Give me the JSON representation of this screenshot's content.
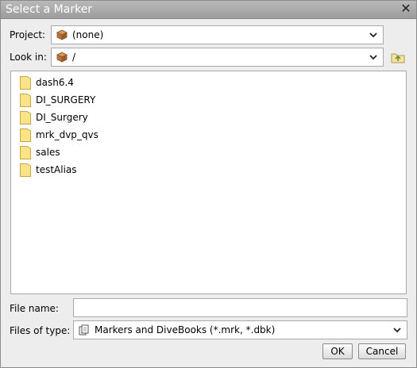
{
  "dialog": {
    "title": "Select a Marker",
    "close_label": "✕"
  },
  "project": {
    "label": "Project:",
    "value": "(none)",
    "icon": "package-icon"
  },
  "lookin": {
    "label": "Look in:",
    "value": "/",
    "icon": "package-icon",
    "up_icon": "up-folder-icon"
  },
  "files": [
    {
      "name": "dash6.4",
      "icon": "folder-icon"
    },
    {
      "name": "DI_SURGERY",
      "icon": "folder-icon"
    },
    {
      "name": "DI_Surgery",
      "icon": "folder-icon"
    },
    {
      "name": "mrk_dvp_qvs",
      "icon": "folder-icon"
    },
    {
      "name": "sales",
      "icon": "folder-icon"
    },
    {
      "name": "testAlias",
      "icon": "folder-icon"
    }
  ],
  "filename": {
    "label": "File name:",
    "value": "",
    "placeholder": ""
  },
  "filetype": {
    "label": "Files of type:",
    "value": "Markers and DiveBooks (*.mrk, *.dbk)",
    "icon": "documents-icon"
  },
  "buttons": {
    "ok": "OK",
    "cancel": "Cancel"
  },
  "colors": {
    "titlebar": "#a8a8a8",
    "dialog_bg": "#ededed",
    "folder_fill": "#fbe38a",
    "package": "#b5743a"
  }
}
